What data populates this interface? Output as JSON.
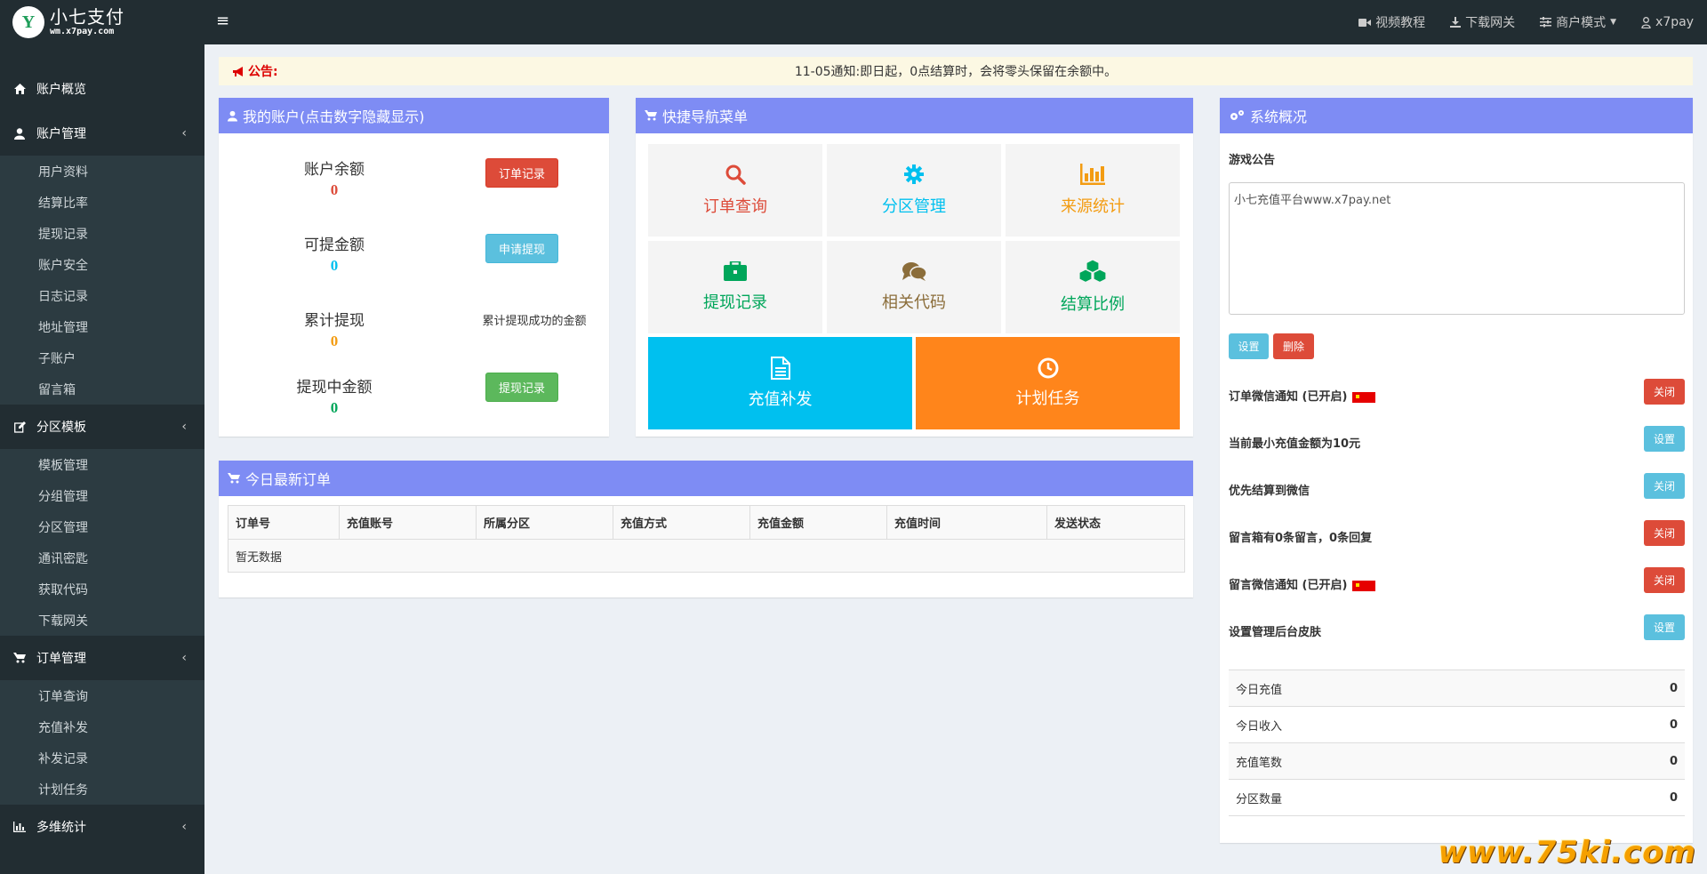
{
  "brand": {
    "title": "小七支付",
    "subtitle": "wm.x7pay.com",
    "logo_letter": "Y"
  },
  "topnav": {
    "video": "视频教程",
    "download": "下载网关",
    "mode": "商户模式",
    "user": "x7pay"
  },
  "sidebar": {
    "groups": [
      {
        "label": "账户概览",
        "icon": "home-icon"
      },
      {
        "label": "账户管理",
        "icon": "user-icon",
        "items": [
          "用户资料",
          "结算比率",
          "提现记录",
          "账户安全",
          "日志记录",
          "地址管理",
          "子账户",
          "留言箱"
        ]
      },
      {
        "label": "分区模板",
        "icon": "edit-icon",
        "items": [
          "模板管理",
          "分组管理",
          "分区管理",
          "通讯密匙",
          "获取代码",
          "下载网关"
        ]
      },
      {
        "label": "订单管理",
        "icon": "cart-icon",
        "items": [
          "订单查询",
          "充值补发",
          "补发记录",
          "计划任务"
        ]
      },
      {
        "label": "多维统计",
        "icon": "bar-chart-icon"
      }
    ]
  },
  "notice": {
    "label": "公告:",
    "text": "11-05通知:即日起，0点结算时，会将零头保留在余额中。"
  },
  "account": {
    "title": "我的账户(点击数字隐藏显示)",
    "rows": [
      {
        "label": "账户余额",
        "value": "0",
        "color": "#dd4b39",
        "button": "订单记录"
      },
      {
        "label": "可提金额",
        "value": "0",
        "color": "#00c0ef",
        "button": "申请提现"
      },
      {
        "label": "累计提现",
        "value": "0",
        "color": "#f39c12",
        "note": "累计提现成功的金额"
      },
      {
        "label": "提现中金额",
        "value": "0",
        "color": "#00a65a",
        "button": "提现记录"
      }
    ]
  },
  "quicknav": {
    "title": "快捷导航菜单",
    "tiles": [
      {
        "label": "订单查询",
        "color": "#dd4b39",
        "icon": "search-icon"
      },
      {
        "label": "分区管理",
        "color": "#00c0ef",
        "icon": "gear-icon"
      },
      {
        "label": "来源统计",
        "color": "#f39c12",
        "icon": "bar-chart-icon"
      },
      {
        "label": "提现记录",
        "color": "#00a65a",
        "icon": "briefcase-icon"
      },
      {
        "label": "相关代码",
        "color": "#8b6d3a",
        "icon": "comments-icon"
      },
      {
        "label": "结算比例",
        "color": "#00a65a",
        "icon": "cubes-icon"
      }
    ],
    "big": [
      {
        "label": "充值补发",
        "color": "#00c0ef",
        "icon": "file-icon"
      },
      {
        "label": "计划任务",
        "color": "#ff851b",
        "icon": "clock-icon"
      }
    ]
  },
  "orders": {
    "title": "今日最新订单",
    "columns": [
      "订单号",
      "充值账号",
      "所属分区",
      "充值方式",
      "充值金额",
      "充值时间",
      "发送状态"
    ],
    "empty": "暂无数据"
  },
  "system": {
    "title": "系统概况",
    "game_notice_label": "游戏公告",
    "game_notice_text": "小七充值平台www.x7pay.net",
    "set_btn": "设置",
    "delete_btn": "删除",
    "settings": [
      {
        "label": "订单微信通知 (已开启)",
        "button": "关闭",
        "style": "red",
        "flag": true
      },
      {
        "label": "当前最小充值金额为10元",
        "button": "设置",
        "style": "cyan"
      },
      {
        "label": "优先结算到微信",
        "button": "关闭",
        "style": "cyan"
      },
      {
        "label": "留言箱有0条留言，0条回复",
        "button": "关闭",
        "style": "red"
      },
      {
        "label": "留言微信通知 (已开启)",
        "button": "关闭",
        "style": "red",
        "flag": true
      },
      {
        "label": "设置管理后台皮肤",
        "button": "设置",
        "style": "cyan"
      }
    ],
    "stats": [
      {
        "label": "今日充值",
        "value": "0"
      },
      {
        "label": "今日收入",
        "value": "0"
      },
      {
        "label": "充值笔数",
        "value": "0"
      },
      {
        "label": "分区数量",
        "value": "0"
      }
    ]
  },
  "watermark": "www.75ki.com"
}
